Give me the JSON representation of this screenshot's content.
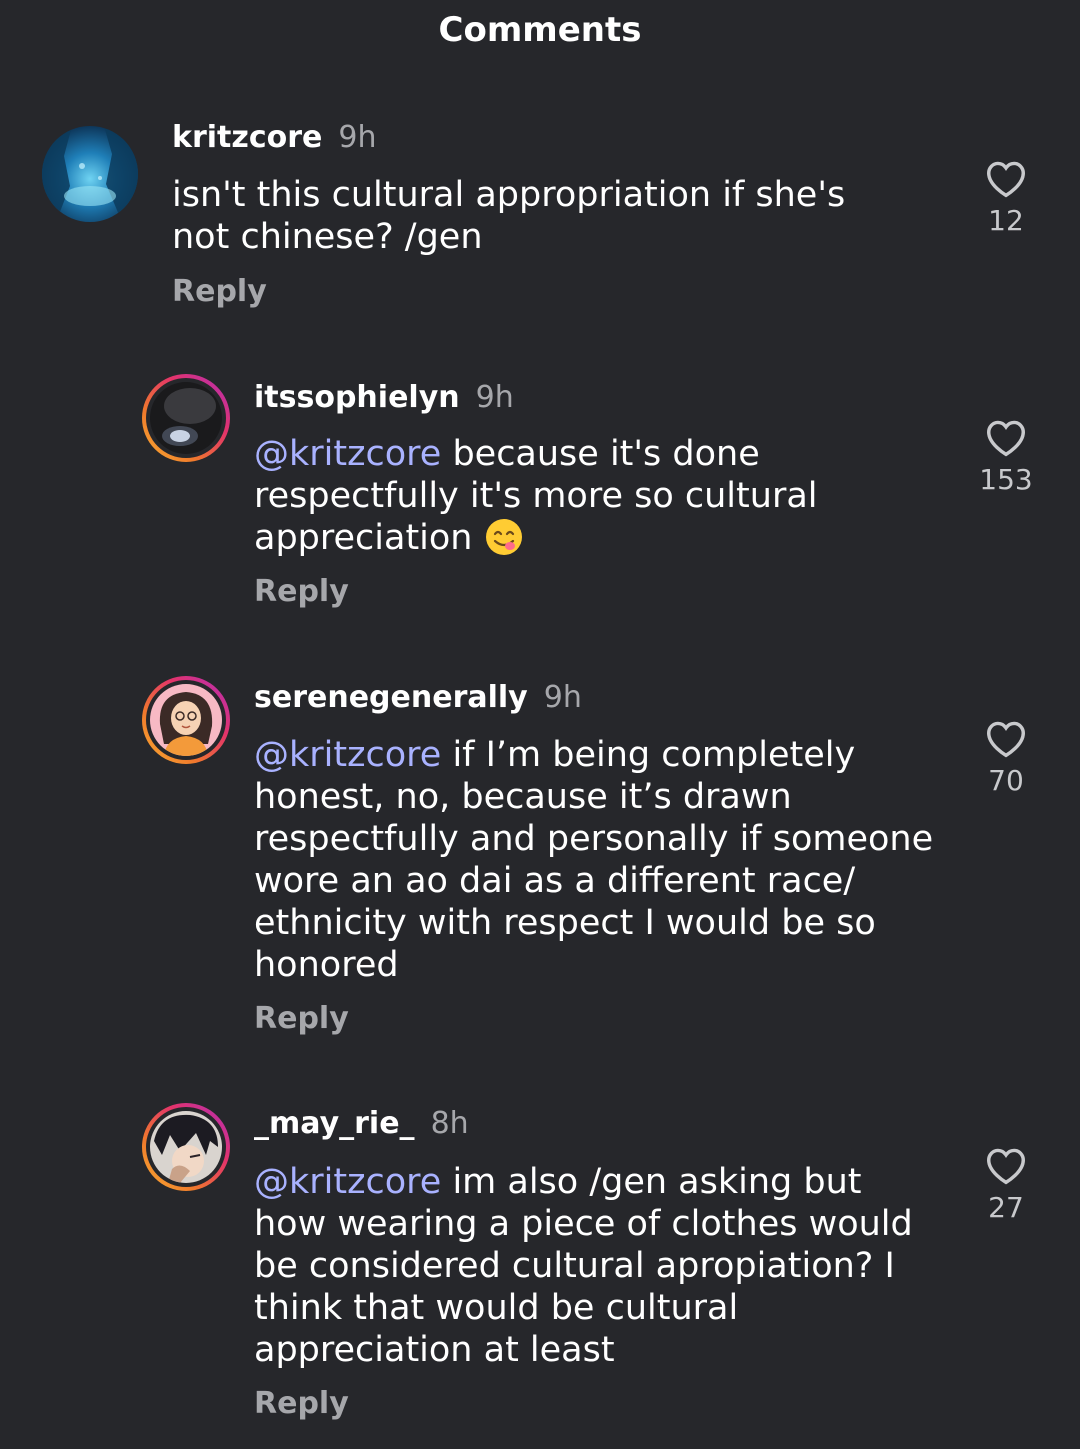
{
  "header": {
    "title": "Comments"
  },
  "comments": [
    {
      "username": "kritzcore",
      "time": "9h",
      "mention": "",
      "text": "isn't this cultural appropriation if she's not chinese? /gen",
      "reply_label": "Reply",
      "likes": "12",
      "avatar_icon": "ocean-cave-avatar"
    },
    {
      "username": "itssophielyn",
      "time": "9h",
      "mention": "@kritzcore",
      "text": "because it's done respectfully it's more so cultural appreciation",
      "emoji": "😋",
      "reply_label": "Reply",
      "likes": "153",
      "avatar_icon": "dark-photo-avatar"
    },
    {
      "username": "serenegenerally",
      "time": "9h",
      "mention": "@kritzcore",
      "text": "if I’m being completely honest, no, because it’s drawn respectfully and personally if someone wore an ao dai as a different race/ ethnicity with respect I would be so honored",
      "reply_label": "Reply",
      "likes": "70",
      "avatar_icon": "illustrated-girl-avatar"
    },
    {
      "username": "_may_rie_",
      "time": "8h",
      "mention": "@kritzcore",
      "text": "im also /gen asking but how wearing a piece of clothes would be considered cultural apropiation? I think that would be cultural appreciation at least",
      "reply_label": "Reply",
      "likes": "27",
      "avatar_icon": "anime-character-avatar"
    }
  ],
  "colors": {
    "background": "#26272b",
    "mention": "#a9b2ff",
    "secondary_text": "#a6a7ab",
    "story_ring_start": "#f9b233",
    "story_ring_end": "#b02ebc"
  }
}
